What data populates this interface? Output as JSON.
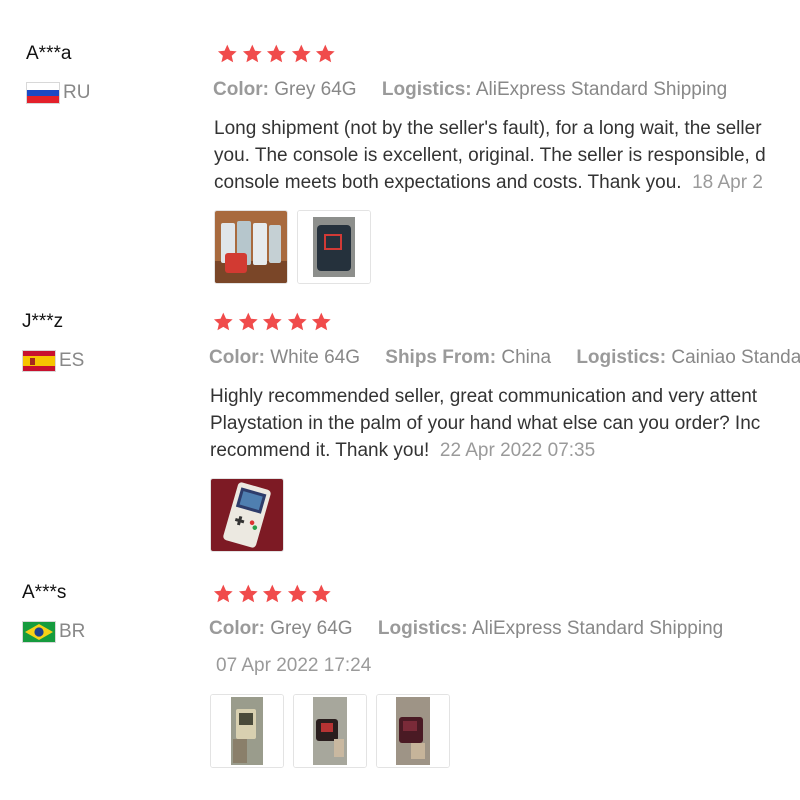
{
  "colors": {
    "star": "#f04b4b",
    "label": "#9a9a9a",
    "body_text": "#333333"
  },
  "reviews": [
    {
      "user": "A***a",
      "country": "RU",
      "stars": 5,
      "meta": [
        {
          "key": "Color:",
          "value": "Grey 64G"
        },
        {
          "key": "Logistics:",
          "value": "AliExpress Standard Shipping"
        }
      ],
      "lines": [
        "Long shipment (not by the seller's fault), for a long wait, the seller",
        "you. The console is excellent, original. The seller is responsible, d",
        "console meets both expectations and costs. Thank you."
      ],
      "date": "18 Apr 2"
    },
    {
      "user": "J***z",
      "country": "ES",
      "stars": 5,
      "meta": [
        {
          "key": "Color:",
          "value": "White 64G"
        },
        {
          "key": "Ships From:",
          "value": "China"
        },
        {
          "key": "Logistics:",
          "value": "Cainiao Standard"
        }
      ],
      "lines": [
        "Highly recommended seller, great communication and very attent",
        "Playstation in the palm of your hand what else can you order? Inc",
        "recommend it. Thank you!"
      ],
      "date": "22 Apr 2022 07:35"
    },
    {
      "user": "A***s",
      "country": "BR",
      "stars": 5,
      "meta": [
        {
          "key": "Color:",
          "value": "Grey 64G"
        },
        {
          "key": "Logistics:",
          "value": "AliExpress Standard Shipping"
        }
      ],
      "lines": [],
      "date": "07 Apr 2022 17:24"
    }
  ]
}
